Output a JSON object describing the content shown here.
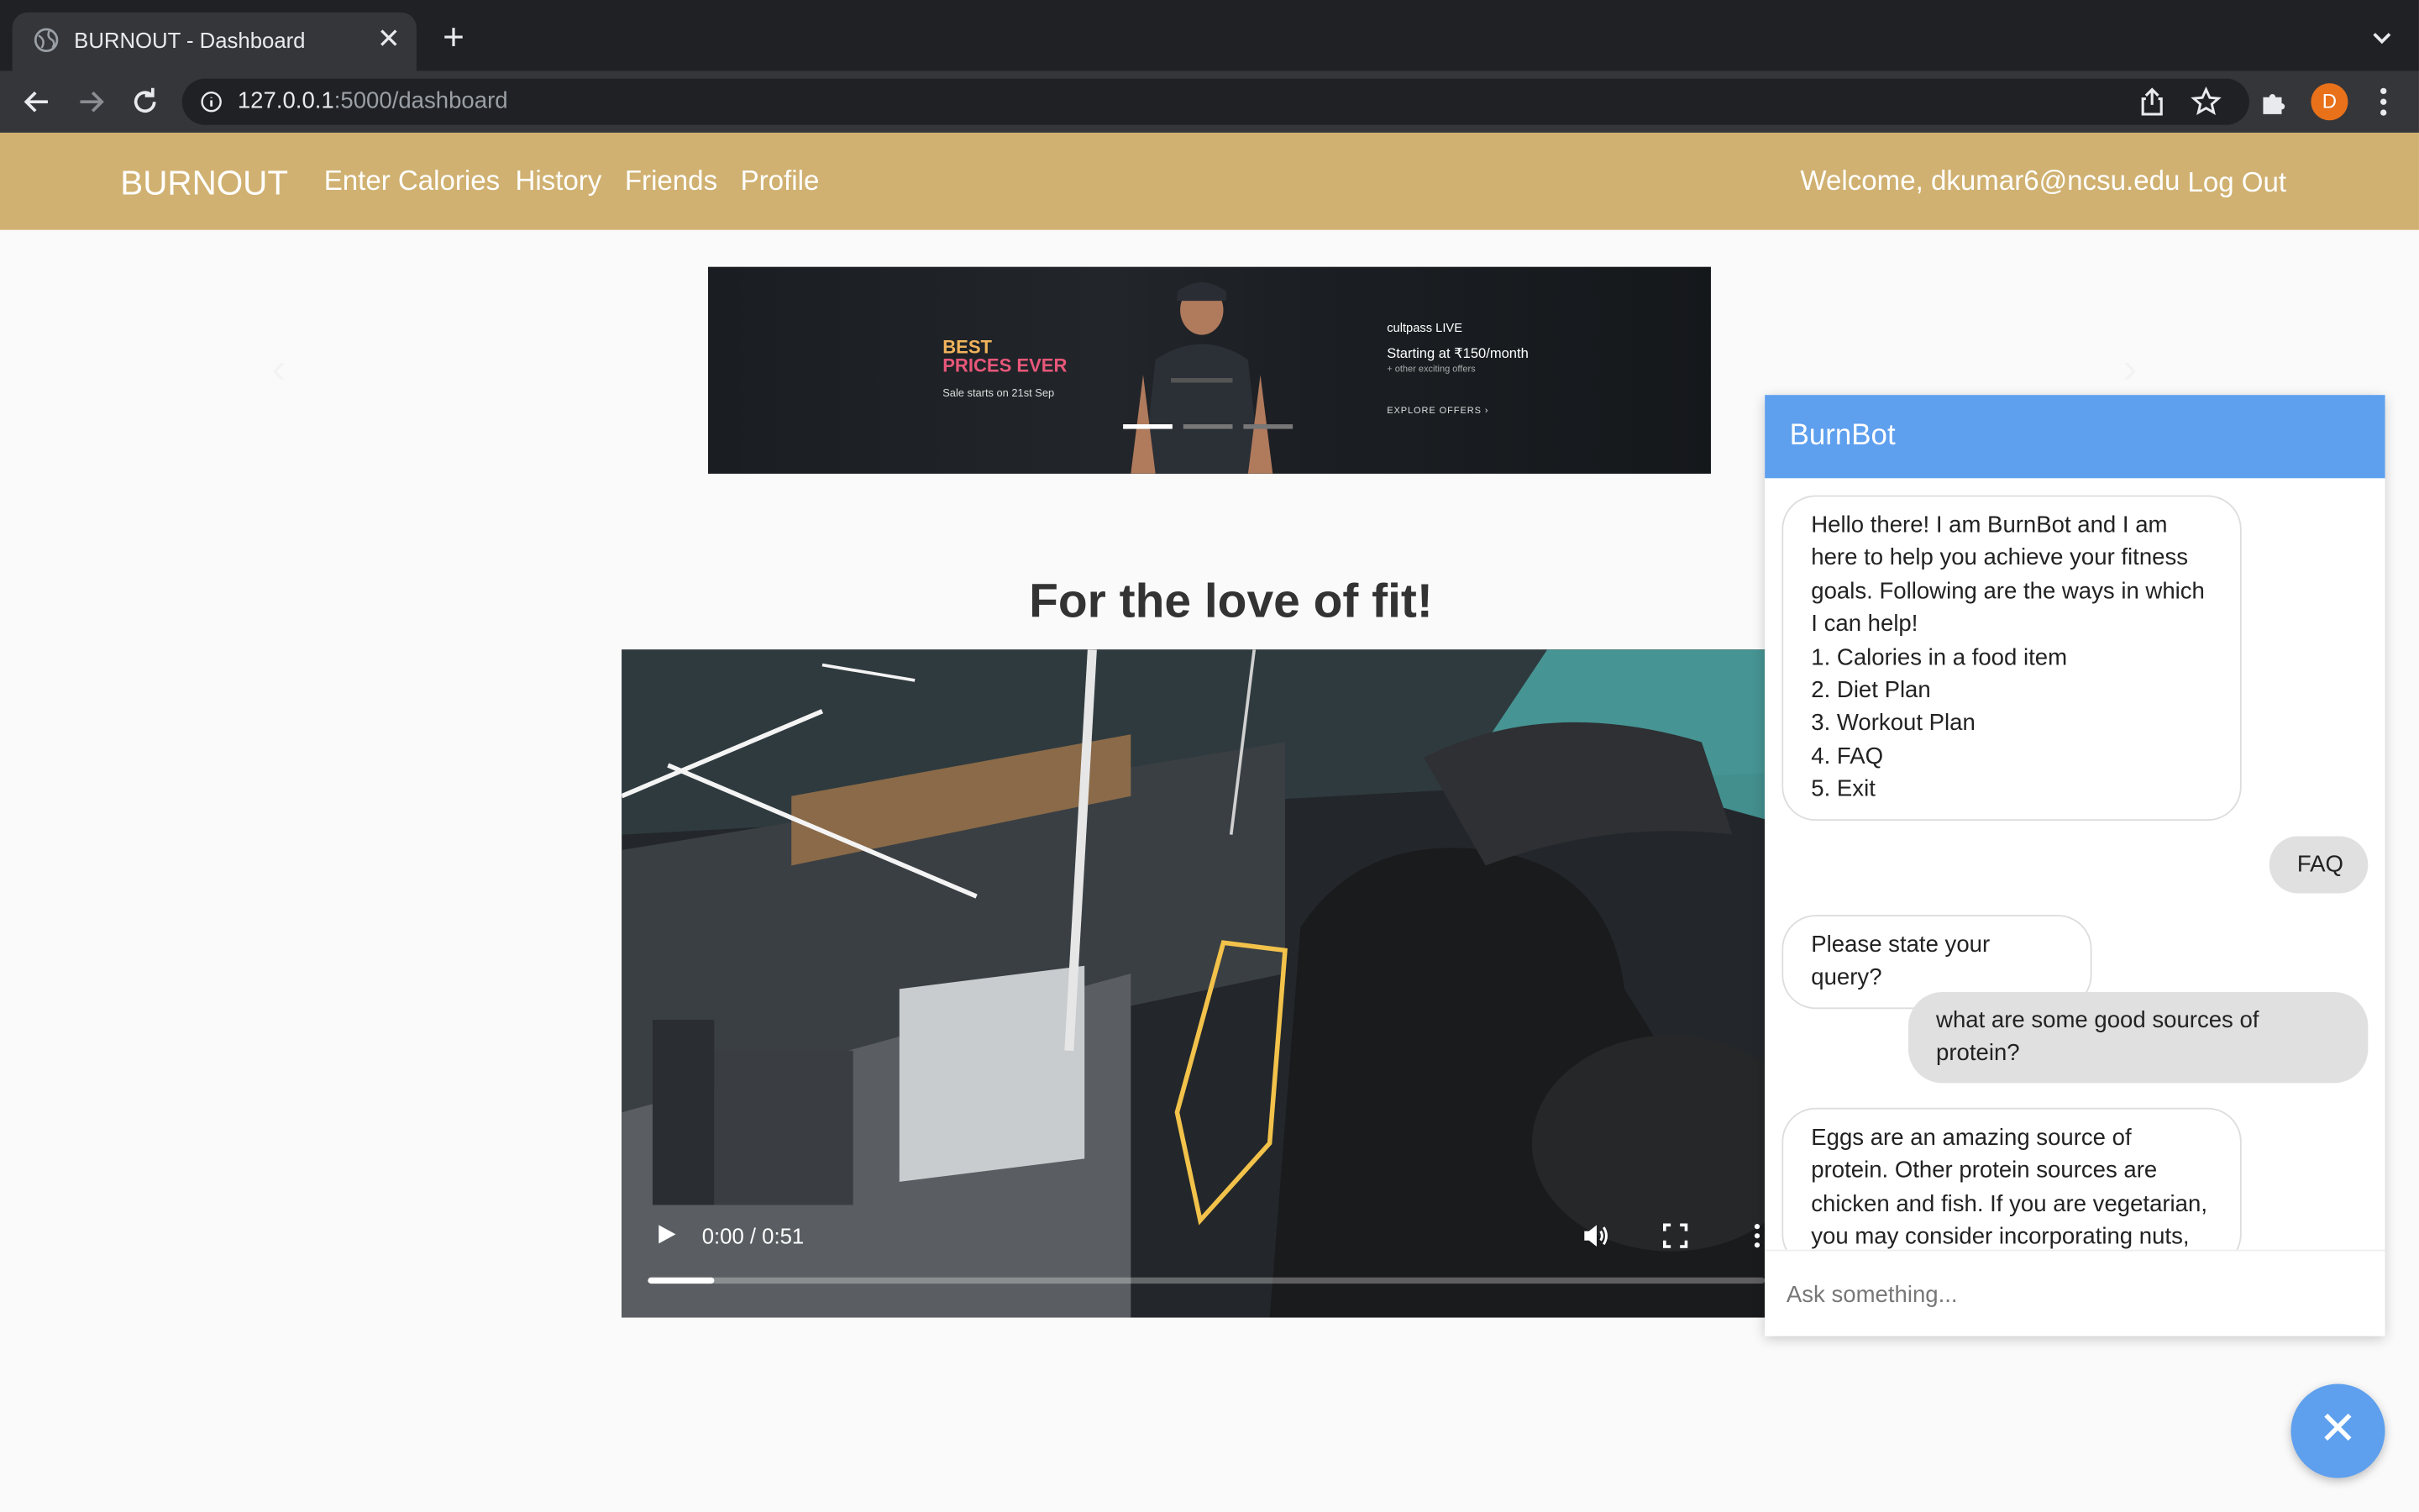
{
  "browser": {
    "tab_title": "BURNOUT - Dashboard",
    "tab_close": "✕",
    "new_tab": "+",
    "url_host": "127.0.0.1",
    "url_path": ":5000/dashboard",
    "avatar_letter": "D"
  },
  "site": {
    "brand": "BURNOUT",
    "nav": [
      "Enter Calories",
      "History",
      "Friends",
      "Profile"
    ],
    "welcome": "Welcome, dkumar6@ncsu.edu",
    "logout": "Log Out",
    "accent_color": "#d0b171"
  },
  "carousel": {
    "title_line1": "BEST",
    "title_line2": "PRICES EVER",
    "subtitle": "Sale starts on 21st Sep",
    "live": "cultpass LIVE",
    "price": "Starting at ₹150/month",
    "other": "+ other exciting offers",
    "explore": "EXPLORE OFFERS ›",
    "active_slide": 1,
    "slide_count": 3
  },
  "headline": "For the love of fit!",
  "video": {
    "time": "0:00 / 0:51",
    "progress": 0.06
  },
  "chat": {
    "title": "BurnBot",
    "header_color": "#5e9fee",
    "input_placeholder": "Ask something...",
    "messages": [
      {
        "from": "bot",
        "lines": [
          "Hello there! I am BurnBot and I am",
          "here to help you achieve your fitness",
          "goals. Following are the ways in which",
          "I can help!",
          "1. Calories in a food item",
          "2. Diet Plan",
          "3. Workout Plan",
          "4. FAQ",
          "5. Exit"
        ]
      },
      {
        "from": "user",
        "lines": [
          "FAQ"
        ]
      },
      {
        "from": "bot",
        "lines": [
          "Please state your query?"
        ]
      },
      {
        "from": "user",
        "lines": [
          "what are some good sources of",
          "protein?"
        ]
      },
      {
        "from": "bot",
        "lines": [
          "Eggs are an amazing source of",
          "protein. Other protein sources are",
          "chicken and fish. If you are vegetarian,",
          "you may consider incorporating nuts,"
        ]
      }
    ],
    "close_symbol": "✕"
  }
}
